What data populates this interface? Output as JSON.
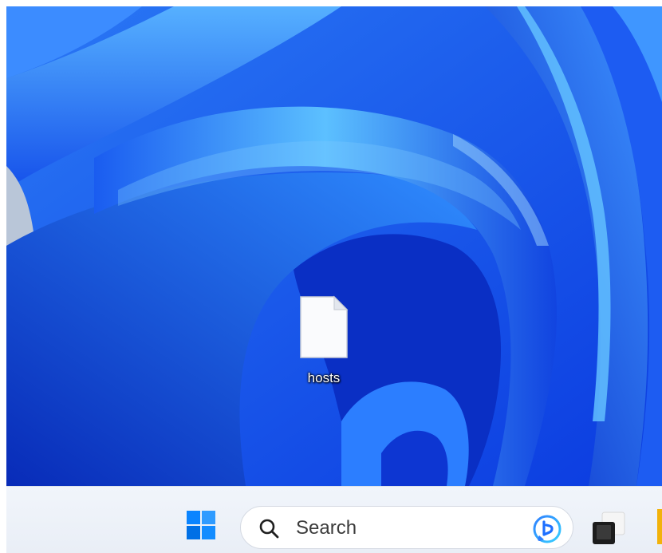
{
  "desktop": {
    "icons": [
      {
        "label": "hosts",
        "icon": "blank-file-icon"
      }
    ]
  },
  "taskbar": {
    "start_icon": "windows-start-icon",
    "search": {
      "placeholder": "Search",
      "icon": "search-icon",
      "badge_icon": "bing-icon"
    },
    "apps": [
      {
        "icon": "task-view-icon"
      },
      {
        "icon": "file-explorer-icon"
      }
    ]
  },
  "colors": {
    "wallpaper_base": "#0a37d8",
    "wallpaper_highlight": "#4aa8ff",
    "taskbar_bg": "#eef2f8",
    "start_blue": "#0a84ff"
  }
}
